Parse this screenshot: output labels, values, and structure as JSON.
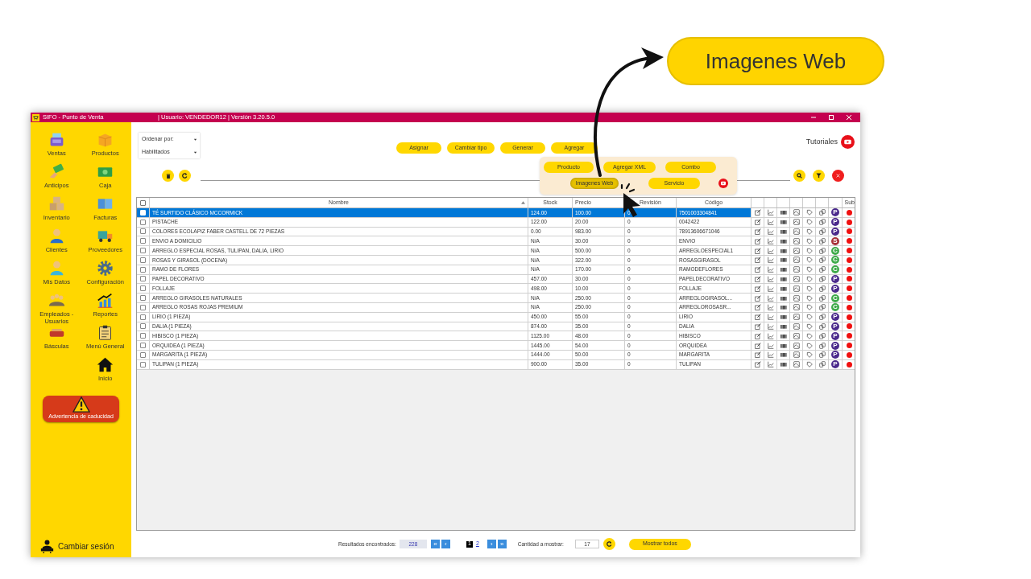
{
  "callout": {
    "label": "Imagenes Web"
  },
  "window": {
    "title": "SIFO - Punto de Venta",
    "user_info": "| Usuario: VENDEDOR12 | Versión 3.20.5.0"
  },
  "sidebar": {
    "items": [
      {
        "label": "Ventas"
      },
      {
        "label": "Productos"
      },
      {
        "label": "Anticipos"
      },
      {
        "label": "Caja"
      },
      {
        "label": "Inventario"
      },
      {
        "label": "Facturas"
      },
      {
        "label": "Clientes"
      },
      {
        "label": "Proveedores"
      },
      {
        "label": "Mis Datos"
      },
      {
        "label": "Configuración"
      },
      {
        "label": "Empleados - Usuarios"
      },
      {
        "label": "Reportes"
      },
      {
        "label": "Básculas"
      },
      {
        "label": "Menú General"
      },
      {
        "label": "Inicio"
      }
    ],
    "warning_button": "Advertencia de caducidad",
    "footer_button": "Cambiar sesión"
  },
  "toolbar": {
    "sort_label": "Ordenar por:",
    "filter_value": "Habilitados",
    "buttons": [
      "Asignar",
      "Cambiar tipo",
      "Generar",
      "Agregar"
    ],
    "tutorials": "Tutoriales",
    "add_menu": {
      "items": [
        {
          "label": "Producto",
          "selected": false
        },
        {
          "label": "Agregar XML",
          "selected": false
        },
        {
          "label": "Combo",
          "selected": false
        },
        {
          "label": "Imagenes Web",
          "selected": true
        },
        {
          "label": "Servicio",
          "selected": false
        }
      ]
    }
  },
  "table": {
    "all_selected": false,
    "columns": [
      "Nombre",
      "Stock",
      "Precio",
      "Revisión",
      "Código",
      "Sub"
    ],
    "rows": [
      {
        "name": "TÉ SURTIDO CLÁSICO MCCORMICK",
        "stock": "124.00",
        "price": "100.00",
        "revision": "0",
        "code": "7501003304841",
        "type": "P",
        "color": "#4b2a8c",
        "selected": true
      },
      {
        "name": "PISTACHE",
        "stock": "122.00",
        "price": "20.00",
        "revision": "0",
        "code": "0042422",
        "type": "P",
        "color": "#4b2a8c",
        "selected": false
      },
      {
        "name": "COLORES ECOLAPIZ FABER CASTELL DE 72 PIEZAS",
        "stock": "0.00",
        "price": "983.00",
        "revision": "0",
        "code": "78913606671046",
        "type": "P",
        "color": "#4b2a8c",
        "selected": false
      },
      {
        "name": "ENVIO A DOMICILIO",
        "stock": "N/A",
        "price": "30.00",
        "revision": "0",
        "code": "ENVIO",
        "type": "S",
        "color": "#a8323a",
        "selected": false
      },
      {
        "name": "ARREGLO ESPECIAL ROSAS, TULIPAN, DALIA, LIRIO",
        "stock": "N/A",
        "price": "500.00",
        "revision": "0",
        "code": "ARREGLOESPECIAL1",
        "type": "C",
        "color": "#3faa4a",
        "selected": false
      },
      {
        "name": "ROSAS Y GIRASOL (DOCENA)",
        "stock": "N/A",
        "price": "322.00",
        "revision": "0",
        "code": "ROSASGIRASOL",
        "type": "C",
        "color": "#3faa4a",
        "selected": false
      },
      {
        "name": "RAMO DE FLORES",
        "stock": "N/A",
        "price": "170.00",
        "revision": "0",
        "code": "RAMODEFLORES",
        "type": "C",
        "color": "#3faa4a",
        "selected": false
      },
      {
        "name": "PAPEL DECORATIVO",
        "stock": "457.00",
        "price": "30.00",
        "revision": "0",
        "code": "PAPELDECORATIVO",
        "type": "P",
        "color": "#4b2a8c",
        "selected": false
      },
      {
        "name": "FOLLAJE",
        "stock": "498.00",
        "price": "10.00",
        "revision": "0",
        "code": "FOLLAJE",
        "type": "P",
        "color": "#4b2a8c",
        "selected": false
      },
      {
        "name": "ARREGLO GIRASOLES NATURALES",
        "stock": "N/A",
        "price": "250.00",
        "revision": "0",
        "code": "ARREGLOGIRASOL...",
        "type": "C",
        "color": "#3faa4a",
        "selected": false
      },
      {
        "name": "ARREGLO ROSAS ROJAS PREMIUM",
        "stock": "N/A",
        "price": "250.00",
        "revision": "0",
        "code": "ARREGLOROSASR...",
        "type": "C",
        "color": "#3faa4a",
        "selected": false
      },
      {
        "name": "LIRIO (1 PIEZA)",
        "stock": "450.00",
        "price": "55.00",
        "revision": "0",
        "code": "LIRIO",
        "type": "P",
        "color": "#4b2a8c",
        "selected": false
      },
      {
        "name": "DALIA (1 PIEZA)",
        "stock": "874.00",
        "price": "35.00",
        "revision": "0",
        "code": "DALIA",
        "type": "P",
        "color": "#4b2a8c",
        "selected": false
      },
      {
        "name": "HIBISCO (1 PIEZA)",
        "stock": "1125.00",
        "price": "48.00",
        "revision": "0",
        "code": "HIBISCO",
        "type": "P",
        "color": "#4b2a8c",
        "selected": false
      },
      {
        "name": "ORQUIDEA (1 PIEZA)",
        "stock": "1445.00",
        "price": "54.00",
        "revision": "0",
        "code": "ORQUIDEA",
        "type": "P",
        "color": "#4b2a8c",
        "selected": false
      },
      {
        "name": "MARGARITA (1 PIEZA)",
        "stock": "1444.00",
        "price": "50.00",
        "revision": "0",
        "code": "MARGARITA",
        "type": "P",
        "color": "#4b2a8c",
        "selected": false
      },
      {
        "name": "TULIPAN (1 PIEZA)",
        "stock": "900.00",
        "price": "35.00",
        "revision": "0",
        "code": "TULIPAN",
        "type": "P",
        "color": "#4b2a8c",
        "selected": false
      }
    ]
  },
  "pagination": {
    "results_label": "Resultados encontrados:",
    "results_count": "228",
    "first": "«",
    "prev": "‹",
    "pages": [
      {
        "label": "1",
        "selected": true
      },
      {
        "label": "2",
        "selected": false
      }
    ],
    "next": "›",
    "last": "»",
    "quantity_label": "Cantidad a mostrar:",
    "quantity": "17",
    "show_all": "Mostrar todos"
  }
}
